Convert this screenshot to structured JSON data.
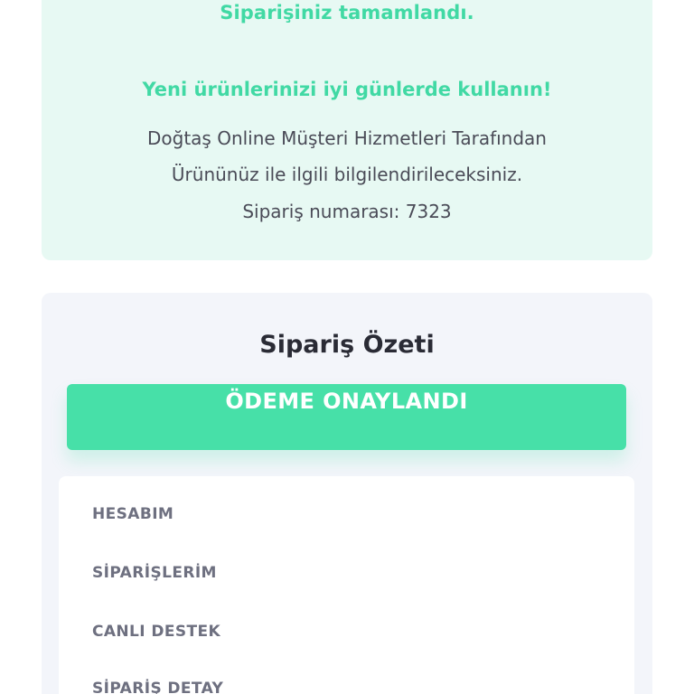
{
  "confirmation": {
    "title": "Siparişiniz tamamlandı.",
    "subtitle": "Yeni ürünlerinizi iyi günlerde kullanın!",
    "info_line_1": "Doğtaş Online Müşteri Hizmetleri Tarafından",
    "info_line_2": "Ürününüz ile ilgili bilgilendirileceksiniz.",
    "order_number_text": "Sipariş numarası: 7323"
  },
  "summary": {
    "title": "Sipariş Özeti",
    "status_label": "ÖDEME ONAYLANDI"
  },
  "menu": {
    "items": [
      {
        "label": "HESABIM"
      },
      {
        "label": "SİPARİŞLERİM"
      },
      {
        "label": "CANLI DESTEK"
      },
      {
        "label": "SİPARİŞ DETAY"
      }
    ]
  },
  "colors": {
    "accent_green": "#47e0a8",
    "confirmation_text_green": "#41d9a4",
    "confirmation_background": "#e7f9f3",
    "summary_background": "#f3f5fa",
    "menu_text": "#6e7080"
  }
}
